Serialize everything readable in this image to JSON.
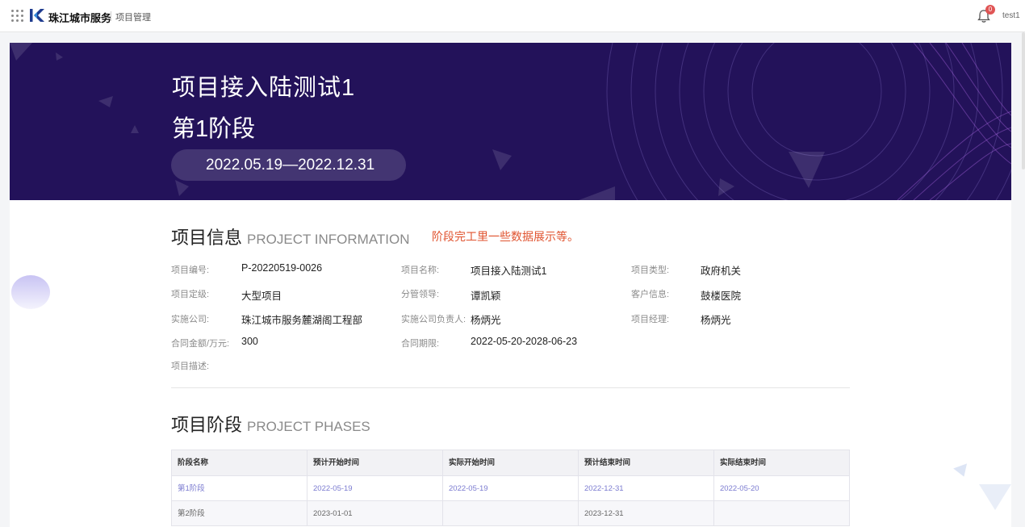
{
  "topbar": {
    "brand": "珠江城市服务",
    "module": "项目管理",
    "notification_count": "0",
    "user": "test1"
  },
  "banner": {
    "project_name": "项目接入陆测试1",
    "phase": "第1阶段",
    "date_range": "2022.05.19—2022.12.31"
  },
  "info": {
    "title": "项目信息",
    "title_en": "PROJECT INFORMATION",
    "note": "阶段完工里一些数据展示等。",
    "fields": {
      "code_label": "项目编号:",
      "code": "P-20220519-0026",
      "name_label": "项目名称:",
      "name": "项目接入陆测试1",
      "type_label": "项目类型:",
      "type": "政府机关",
      "grade_label": "项目定级:",
      "grade": "大型项目",
      "leader_label": "分管领导:",
      "leader": "谭凯颖",
      "customer_label": "客户信息:",
      "customer": "鼓楼医院",
      "company_label": "实施公司:",
      "company": "珠江城市服务麓湖阁工程部",
      "company_head_label": "实施公司负责人:",
      "company_head": "杨炳光",
      "manager_label": "项目经理:",
      "manager": "杨炳光",
      "amount_label": "合同金额/万元:",
      "amount": "300",
      "period_label": "合同期限:",
      "period": "2022-05-20-2028-06-23",
      "desc_label": "项目描述:"
    }
  },
  "phases": {
    "title": "项目阶段",
    "title_en": "PROJECT PHASES",
    "columns": [
      "阶段名称",
      "预计开始时间",
      "实际开始时间",
      "预计结束时间",
      "实际结束时间"
    ],
    "rows": [
      [
        "第1阶段",
        "2022-05-19",
        "2022-05-19",
        "2022-12-31",
        "2022-05-20"
      ],
      [
        "第2阶段",
        "2023-01-01",
        "",
        "2023-12-31",
        ""
      ]
    ]
  },
  "colors": {
    "banner_bg": "#23125a",
    "accent_note": "#e0532f",
    "link": "#7b7bd0"
  }
}
